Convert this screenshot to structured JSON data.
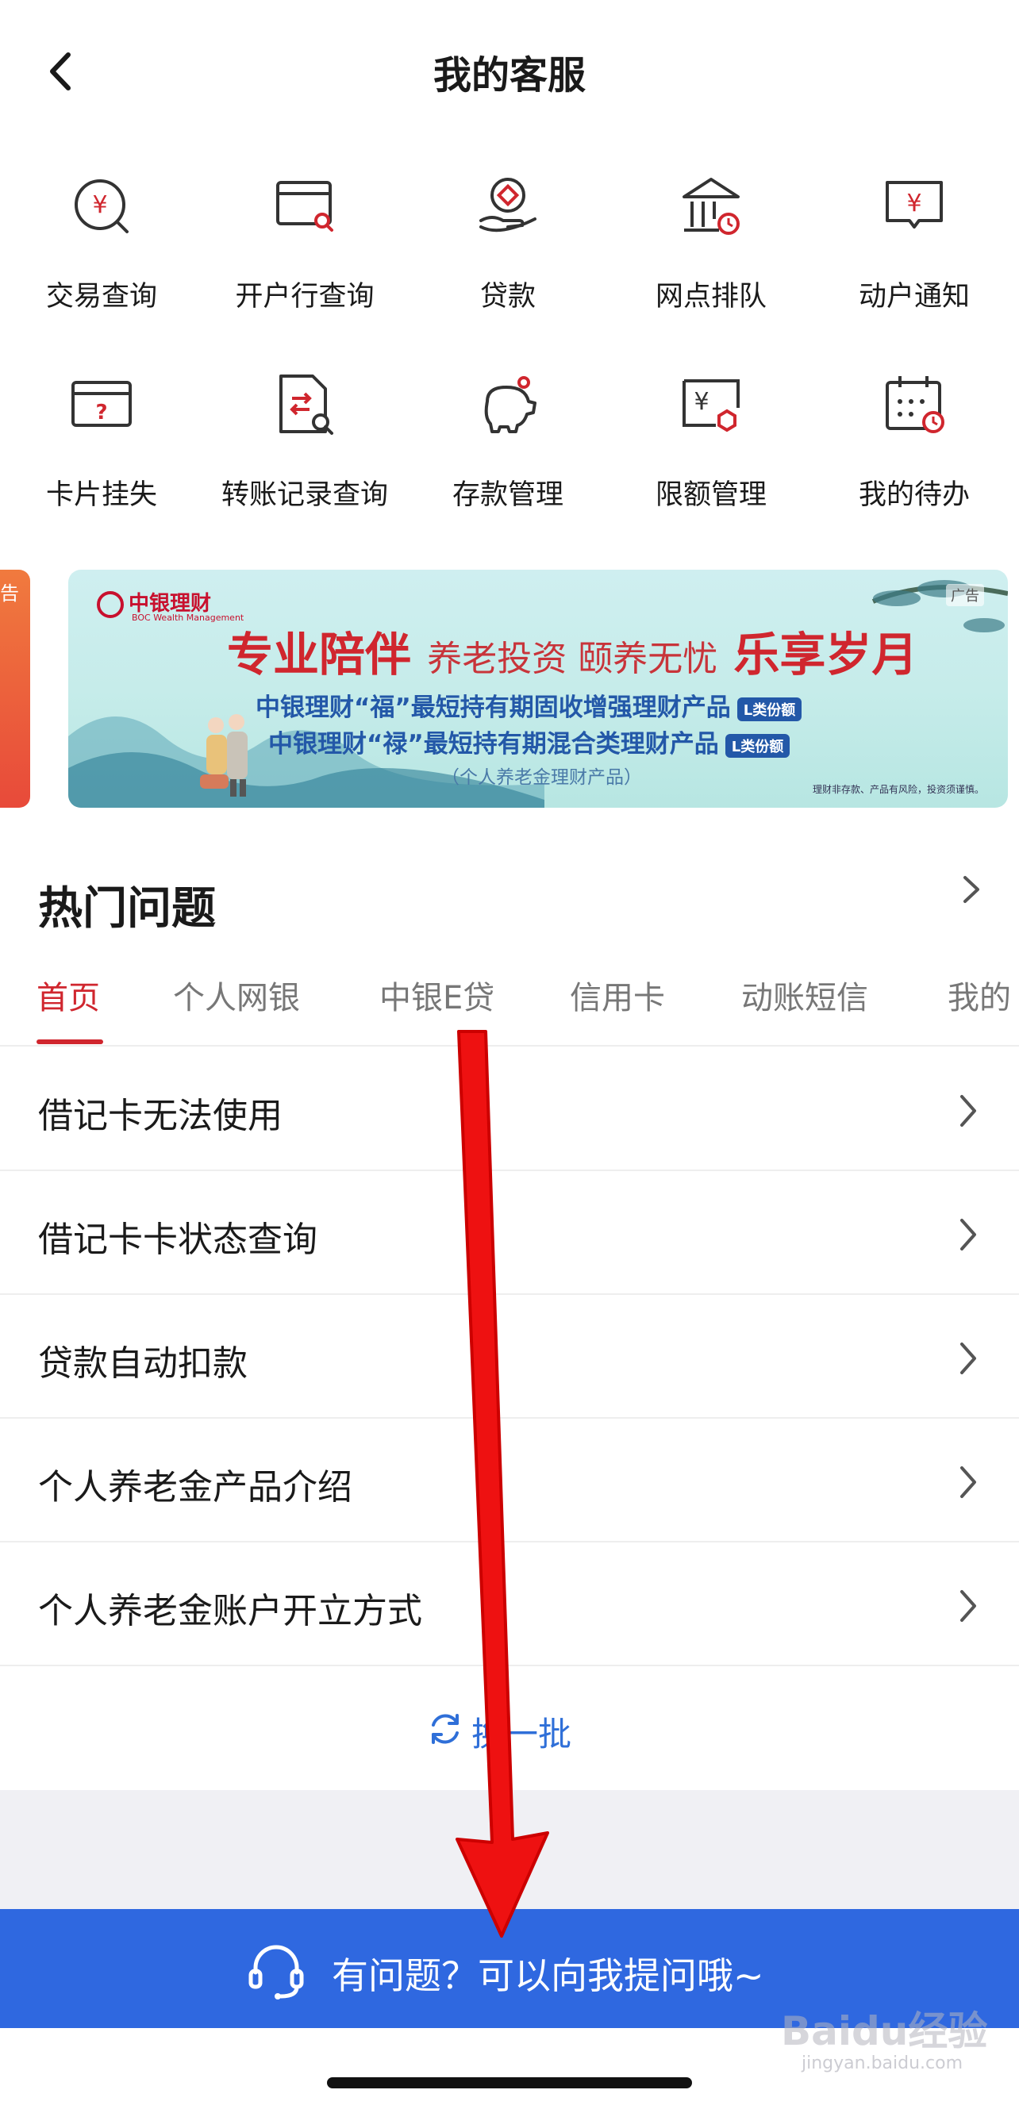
{
  "header": {
    "title": "我的客服",
    "back_icon": "chevron-left-icon"
  },
  "grid": [
    {
      "label": "交易查询",
      "icon": "yuan-search-icon"
    },
    {
      "label": "开户行查询",
      "icon": "card-search-icon"
    },
    {
      "label": "贷款",
      "icon": "hand-coin-icon"
    },
    {
      "label": "网点排队",
      "icon": "bank-clock-icon"
    },
    {
      "label": "动户通知",
      "icon": "yuan-message-icon"
    },
    {
      "label": "卡片挂失",
      "icon": "card-question-icon"
    },
    {
      "label": "转账记录查询",
      "icon": "transfer-doc-icon"
    },
    {
      "label": "存款管理",
      "icon": "piggy-bank-icon"
    },
    {
      "label": "限额管理",
      "icon": "yuan-limit-icon"
    },
    {
      "label": "我的待办",
      "icon": "calendar-clock-icon"
    }
  ],
  "banner": {
    "peek_text": "告",
    "logo": "中银理财",
    "logo_sub": "BOC Wealth Management",
    "ad_badge": "广告",
    "headline_a": "专业陪伴",
    "headline_mid": "养老投资 颐养无忧",
    "headline_b": "乐享岁月",
    "line1": "中银理财“福”最短持有期固收增强理财产品",
    "line1_tag": "L类份额",
    "line2": "中银理财“禄”最短持有期混合类理财产品",
    "line2_tag": "L类份额",
    "line3": "（个人养老金理财产品）",
    "disclaimer": "理财非存款、产品有风险，投资须谨慎。"
  },
  "hot": {
    "title": "热门问题",
    "tabs": [
      "首页",
      "个人网银",
      "中银E贷",
      "信用卡",
      "动账短信",
      "我的"
    ],
    "active_tab": "首页",
    "questions": [
      "借记卡无法使用",
      "借记卡卡状态查询",
      "贷款自动扣款",
      "个人养老金产品介绍",
      "个人养老金账户开立方式"
    ],
    "refresh_label": "换一批"
  },
  "ask": {
    "label": "有问题？可以向我提问哦~",
    "icon": "headset-icon"
  },
  "watermark": {
    "text": "Baidu经验",
    "sub": "jingyan.baidu.com"
  },
  "colors": {
    "brand_red": "#d0262e",
    "ask_blue": "#2f68e0",
    "link_blue": "#2f6fd8"
  }
}
